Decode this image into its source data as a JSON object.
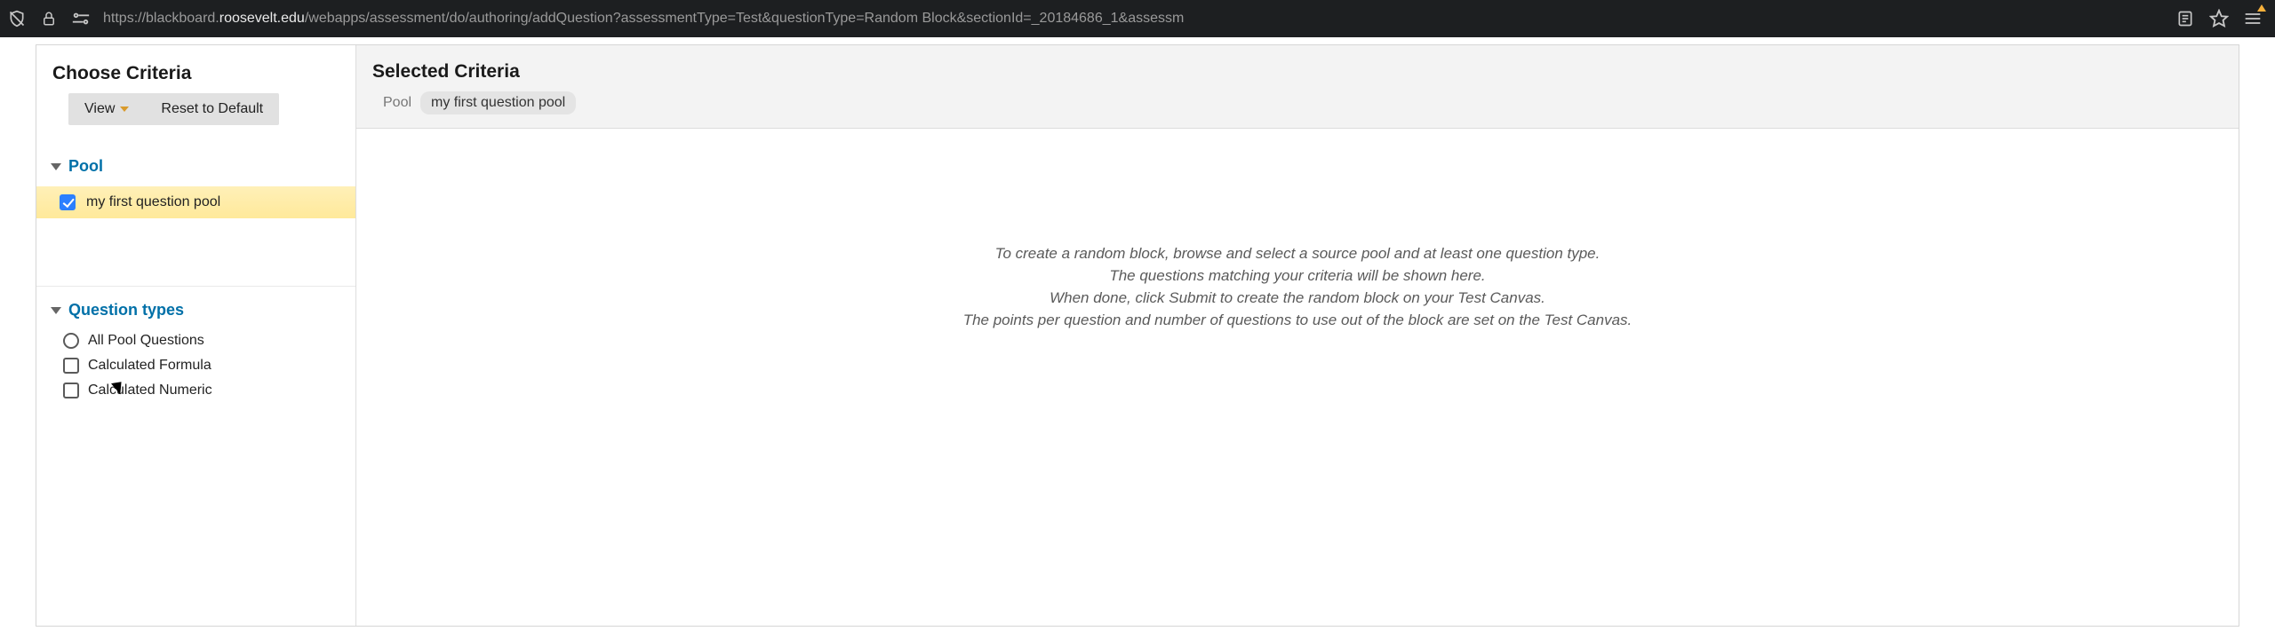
{
  "browser": {
    "url_prefix": "https://blackboard.",
    "url_domain": "roosevelt.edu",
    "url_rest": "/webapps/assessment/do/authoring/addQuestion?assessmentType=Test&questionType=Random Block&sectionId=_20184686_1&assessm"
  },
  "sidebar": {
    "title": "Choose Criteria",
    "view_label": "View",
    "reset_label": "Reset to Default",
    "pool_heading": "Pool",
    "pool_items": [
      {
        "label": "my first question pool",
        "checked": true
      }
    ],
    "qtypes_heading": "Question types",
    "qtypes": [
      {
        "label": "All Pool Questions",
        "kind": "radio"
      },
      {
        "label": "Calculated Formula",
        "kind": "check"
      },
      {
        "label": "Calculated Numeric",
        "kind": "check"
      }
    ]
  },
  "main": {
    "title": "Selected Criteria",
    "pool_label": "Pool",
    "chip": "my first question pool",
    "placeholder": [
      "To create a random block, browse and select a source pool and at least one question type.",
      "The questions matching your criteria will be shown here.",
      "When done, click Submit to create the random block on your Test Canvas.",
      "The points per question and number of questions to use out of the block are set on the Test Canvas."
    ]
  }
}
